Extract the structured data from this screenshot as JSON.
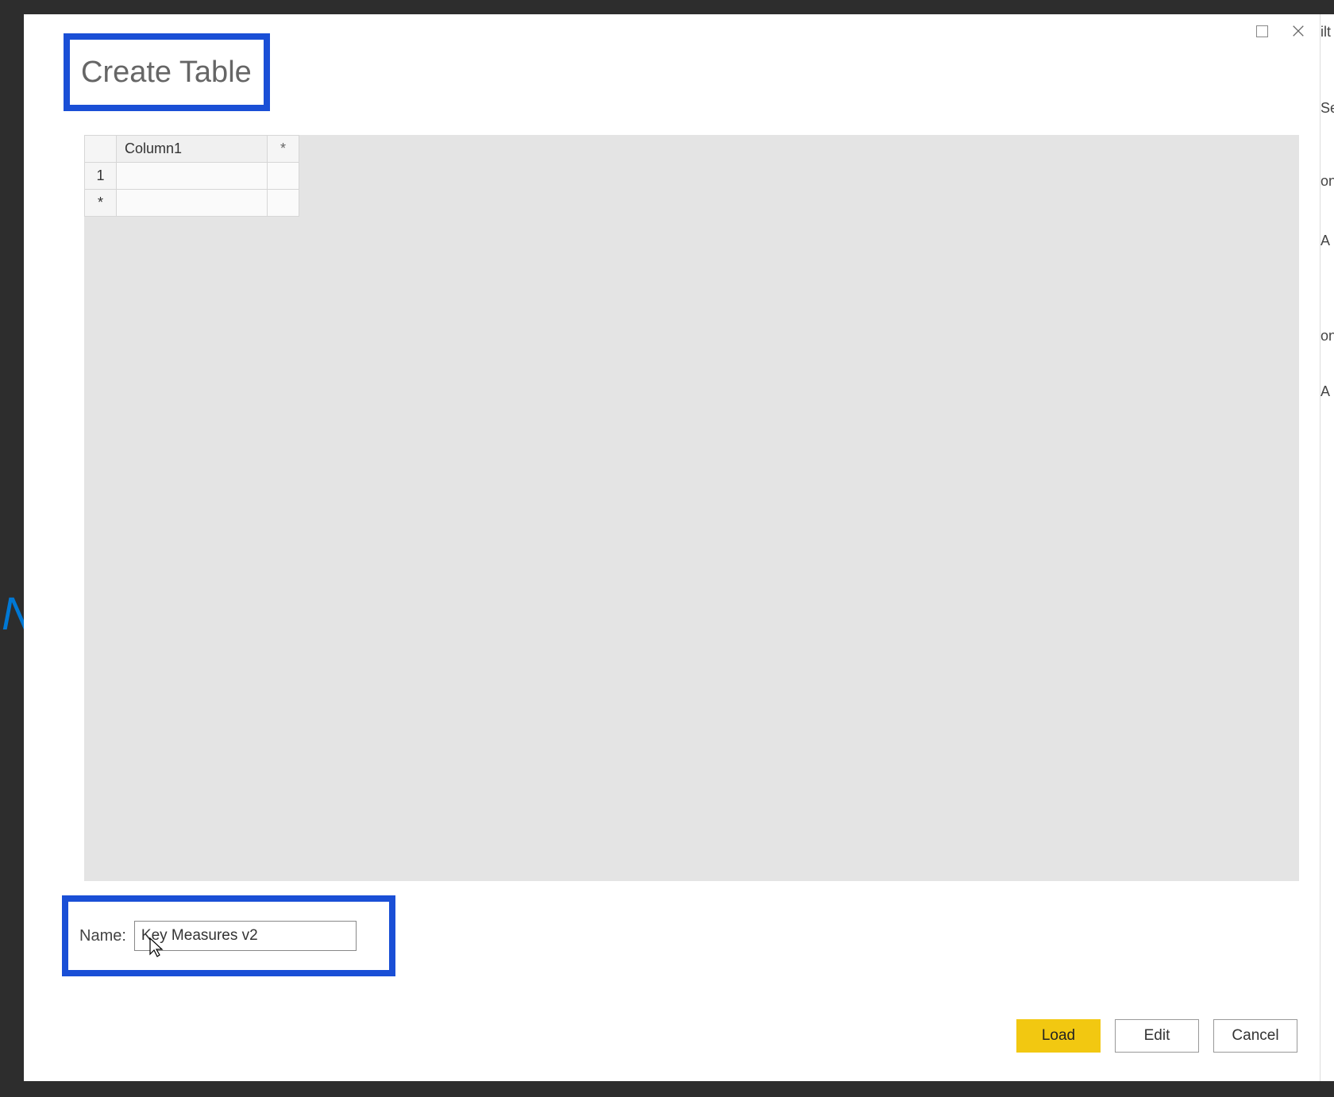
{
  "dialog": {
    "title": "Create Table",
    "window_controls": {
      "maximize": "maximize",
      "close": "close"
    }
  },
  "grid": {
    "column_header": "Column1",
    "add_column_marker": "*",
    "rows": [
      {
        "num": "1",
        "value": ""
      }
    ],
    "add_row_marker": "*"
  },
  "name_field": {
    "label": "Name:",
    "value": "Key Measures v2"
  },
  "buttons": {
    "load": "Load",
    "edit": "Edit",
    "cancel": "Cancel"
  },
  "right_panel": {
    "frag1": "ilt",
    "frag2": "Se",
    "frag3": "on",
    "frag4": "A",
    "frag5": "on",
    "frag6": "A"
  }
}
